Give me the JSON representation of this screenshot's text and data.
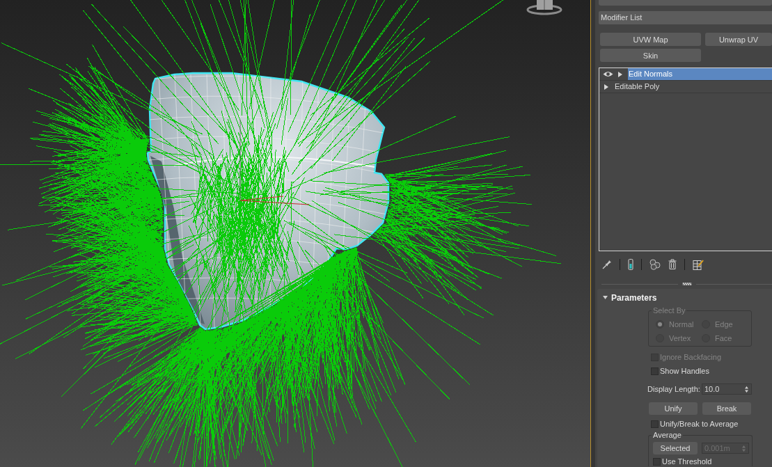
{
  "modifier_list": {
    "label": "Modifier List"
  },
  "modifier_buttons": [
    "UVW Map",
    "Unwrap UV",
    "Skin"
  ],
  "modifier_stack": [
    {
      "label": "Edit Normals",
      "kind": "modifier",
      "selected": true,
      "expanded": false
    },
    {
      "label": "Editable Poly",
      "kind": "object",
      "selected": false,
      "expanded": false
    }
  ],
  "parameters": {
    "title": "Parameters",
    "expanded": true,
    "select_by": {
      "title": "Select By",
      "disabled": true,
      "options": [
        {
          "label": "Normal",
          "selected": true
        },
        {
          "label": "Edge",
          "selected": false
        },
        {
          "label": "Vertex",
          "selected": false
        },
        {
          "label": "Face",
          "selected": false
        }
      ]
    },
    "ignore_backfacing": {
      "label": "Ignore Backfacing",
      "checked": false,
      "disabled": true
    },
    "show_handles": {
      "label": "Show Handles",
      "checked": false,
      "disabled": false
    },
    "display_length": {
      "label": "Display Length:",
      "value": "10.0"
    },
    "buttons": [
      "Unify",
      "Break"
    ],
    "unify_break_to_average": {
      "label": "Unify/Break to Average",
      "checked": false,
      "disabled": false
    },
    "average": {
      "title": "Average",
      "button": "Selected",
      "threshold": {
        "value": "0.001m",
        "disabled": true
      },
      "use_threshold": {
        "label": "Use Threshold",
        "checked": false,
        "disabled": false
      }
    }
  }
}
